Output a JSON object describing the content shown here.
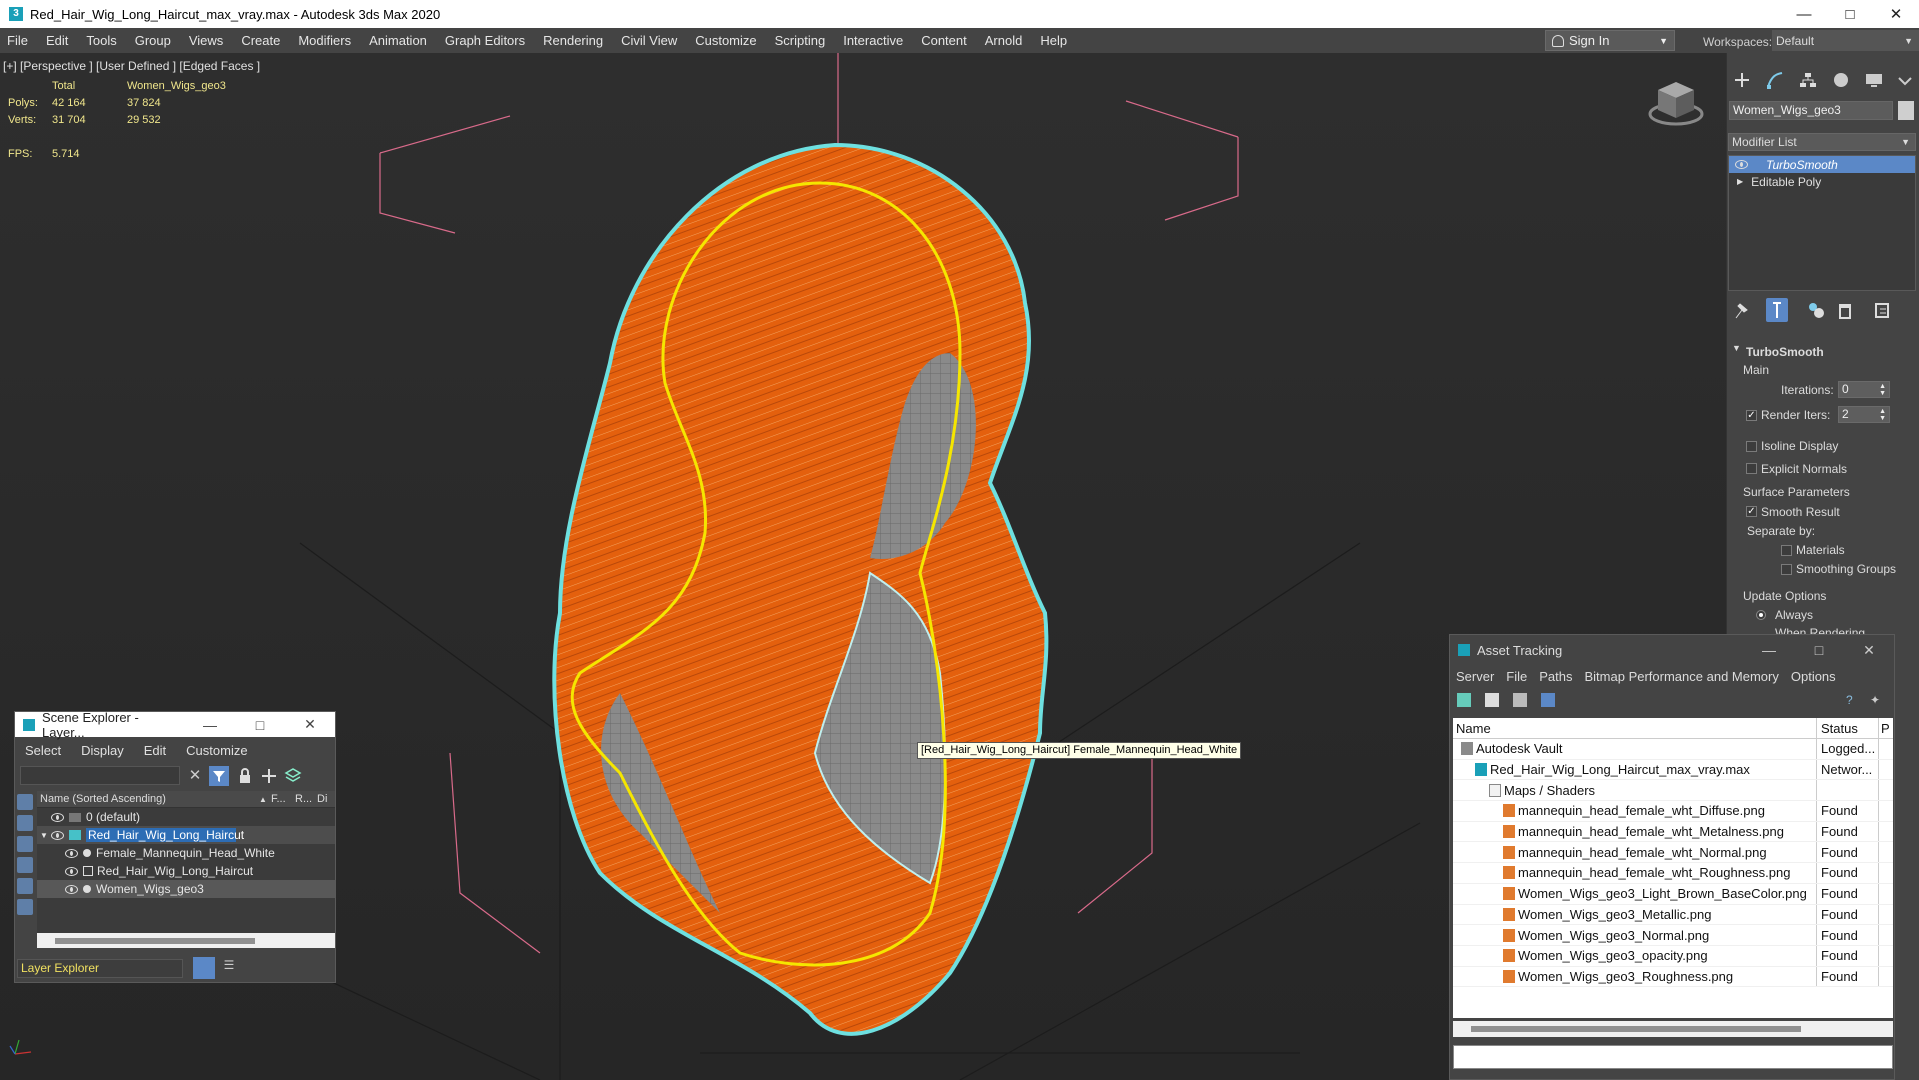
{
  "app": {
    "window_title": "Red_Hair_Wig_Long_Haircut_max_vray.max - Autodesk 3ds Max 2020",
    "menu": [
      "File",
      "Edit",
      "Tools",
      "Group",
      "Views",
      "Create",
      "Modifiers",
      "Animation",
      "Graph Editors",
      "Rendering",
      "Civil View",
      "Customize",
      "Scripting",
      "Interactive",
      "Content",
      "Arnold",
      "Help"
    ],
    "sign_in": "Sign In",
    "workspaces_label": "Workspaces:",
    "workspace_value": "Default"
  },
  "viewport": {
    "label": "[+] [Perspective ] [User Defined ] [Edged Faces ]",
    "stats": {
      "col_total": "Total",
      "col_object": "Women_Wigs_geo3",
      "polys_label": "Polys:",
      "polys_total": "42 164",
      "polys_object": "37 824",
      "verts_label": "Verts:",
      "verts_total": "31 704",
      "verts_object": "29 532",
      "fps_label": "FPS:",
      "fps_value": "5.714"
    },
    "tooltip": "[Red_Hair_Wig_Long_Haircut] Female_Mannequin_Head_White",
    "colors": {
      "hair": "#e8620c",
      "selection": "#f5e600",
      "outline": "#6ee0e0",
      "grid": "#1a1a1a"
    }
  },
  "command_panel": {
    "object_name": "Women_Wigs_geo3",
    "modifier_list": "Modifier List",
    "stack": [
      {
        "label": "TurboSmooth",
        "selected": true
      },
      {
        "label": "Editable Poly",
        "selected": false
      }
    ],
    "turbosmooth": {
      "title": "TurboSmooth",
      "main": "Main",
      "iterations_label": "Iterations:",
      "iterations_value": "0",
      "render_iters_label": "Render Iters:",
      "render_iters_value": "2",
      "render_iters_checked": true,
      "isoline": "Isoline Display",
      "explicit_normals": "Explicit Normals",
      "surface_params": "Surface Parameters",
      "smooth_result": "Smooth Result",
      "separate_by": "Separate by:",
      "materials": "Materials",
      "smoothing_groups": "Smoothing Groups",
      "update_options": "Update Options",
      "always": "Always",
      "when_rendering": "When Rendering"
    }
  },
  "scene_explorer": {
    "title": "Scene Explorer - Layer...",
    "menu": [
      "Select",
      "Display",
      "Edit",
      "Customize"
    ],
    "columns": {
      "name": "Name (Sorted Ascending)",
      "sort": "▲",
      "f": "F...",
      "r": "R...",
      "d": "Di"
    },
    "rows": [
      {
        "name": "0 (default)",
        "indent": 0,
        "type": "layer",
        "expanded": false,
        "selected": false
      },
      {
        "name": "Red_Hair_Wig_Long_Haircut",
        "indent": 0,
        "type": "layer",
        "expanded": true,
        "selected": true
      },
      {
        "name": "Female_Mannequin_Head_White",
        "indent": 1,
        "type": "object",
        "selected": false
      },
      {
        "name": "Red_Hair_Wig_Long_Haircut",
        "indent": 1,
        "type": "group",
        "selected": false
      },
      {
        "name": "Women_Wigs_geo3",
        "indent": 1,
        "type": "object",
        "selected": false,
        "highlight": true
      }
    ],
    "bottom_dropdown": "Layer Explorer"
  },
  "asset_tracking": {
    "title": "Asset Tracking",
    "menu": [
      "Server",
      "File",
      "Paths",
      "Bitmap Performance and Memory",
      "Options"
    ],
    "columns": {
      "name": "Name",
      "status": "Status",
      "p": "P"
    },
    "rows": [
      {
        "name": "Autodesk Vault",
        "status": "Logged...",
        "indent": 0,
        "icon": "vault"
      },
      {
        "name": "Red_Hair_Wig_Long_Haircut_max_vray.max",
        "status": "Networ...",
        "indent": 1,
        "icon": "max"
      },
      {
        "name": "Maps / Shaders",
        "status": "",
        "indent": 2,
        "icon": "folder"
      },
      {
        "name": "mannequin_head_female_wht_Diffuse.png",
        "status": "Found",
        "indent": 3,
        "icon": "image"
      },
      {
        "name": "mannequin_head_female_wht_Metalness.png",
        "status": "Found",
        "indent": 3,
        "icon": "image"
      },
      {
        "name": "mannequin_head_female_wht_Normal.png",
        "status": "Found",
        "indent": 3,
        "icon": "image"
      },
      {
        "name": "mannequin_head_female_wht_Roughness.png",
        "status": "Found",
        "indent": 3,
        "icon": "image"
      },
      {
        "name": "Women_Wigs_geo3_Light_Brown_BaseColor.png",
        "status": "Found",
        "indent": 3,
        "icon": "image"
      },
      {
        "name": "Women_Wigs_geo3_Metallic.png",
        "status": "Found",
        "indent": 3,
        "icon": "image"
      },
      {
        "name": "Women_Wigs_geo3_Normal.png",
        "status": "Found",
        "indent": 3,
        "icon": "image"
      },
      {
        "name": "Women_Wigs_geo3_opacity.png",
        "status": "Found",
        "indent": 3,
        "icon": "image"
      },
      {
        "name": "Women_Wigs_geo3_Roughness.png",
        "status": "Found",
        "indent": 3,
        "icon": "image"
      }
    ]
  }
}
